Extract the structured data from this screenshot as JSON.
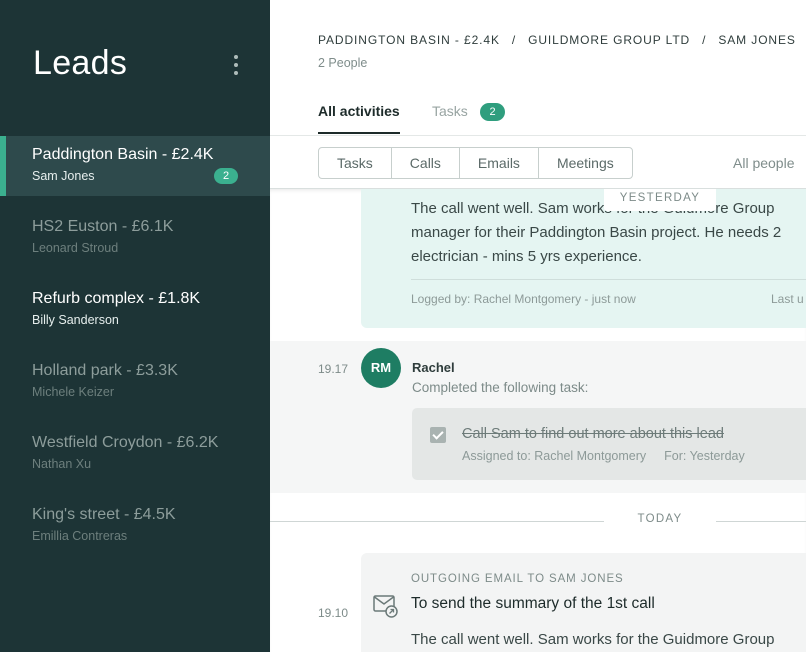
{
  "sidebar": {
    "title": "Leads",
    "leads": [
      {
        "name": "Paddington Basin - £2.4K",
        "contact": "Sam Jones",
        "badge": "2"
      },
      {
        "name": "HS2 Euston - £6.1K",
        "contact": "Leonard Stroud"
      },
      {
        "name": "Refurb complex - £1.8K",
        "contact": "Billy Sanderson"
      },
      {
        "name": "Holland park - £3.3K",
        "contact": "Michele Keizer"
      },
      {
        "name": "Westfield Croydon - £6.2K",
        "contact": "Nathan Xu"
      },
      {
        "name": "King's street - £4.5K",
        "contact": "Emillia Contreras"
      }
    ]
  },
  "header": {
    "breadcrumb": [
      "PADDINGTON BASIN - £2.4K",
      "GUILDMORE GROUP LTD",
      "SAM JONES"
    ],
    "separator": "/",
    "people": "2 People",
    "tabs": {
      "all": "All activities",
      "tasks": "Tasks",
      "tasks_badge": "2"
    }
  },
  "filters": {
    "buttons": [
      "Tasks",
      "Calls",
      "Emails",
      "Meetings"
    ],
    "people": "All people"
  },
  "feed": {
    "call": {
      "lines": [
        "The call went well. Sam works for the Guidmore Group",
        "manager for their Paddington Basin project. He needs 2",
        "electrician - mins 5 yrs experience."
      ],
      "logged": "Logged by: Rachel Montgomery - just now",
      "last": "Last u",
      "divider_label": "YESTERDAY"
    },
    "task": {
      "time": "19.17",
      "initials": "RM",
      "author": "Rachel",
      "description": "Completed the following task:",
      "title": "Call Sam to find out more about this lead",
      "assigned": "Assigned to: Rachel Montgomery",
      "due": "For: Yesterday"
    },
    "today_label": "TODAY",
    "email": {
      "time": "19.10",
      "type": "OUTGOING EMAIL TO SAM JONES",
      "subject": "To send the summary of the 1st call",
      "body": "The call went well. Sam works for the Guidmore Group"
    }
  },
  "colors": {
    "sidebar_bg": "#1d3436",
    "accent": "#3bb08f",
    "call_card_bg": "#e5f5f2"
  }
}
